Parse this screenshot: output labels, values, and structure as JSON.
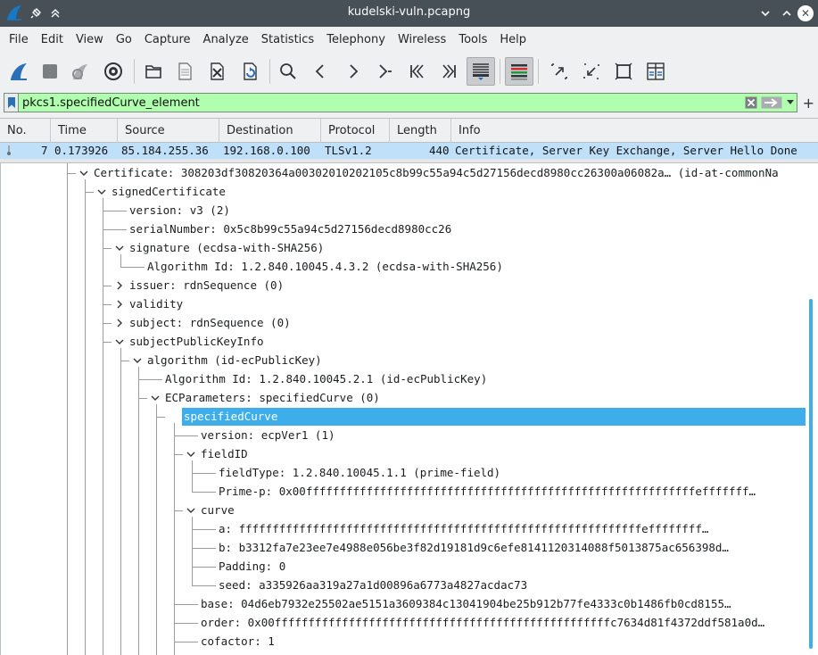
{
  "window": {
    "title": "kudelski-vuln.pcapng"
  },
  "menu": [
    "File",
    "Edit",
    "View",
    "Go",
    "Capture",
    "Analyze",
    "Statistics",
    "Telephony",
    "Wireless",
    "Tools",
    "Help"
  ],
  "toolbar": {
    "icons": [
      "start-capture-icon",
      "stop-capture-icon",
      "restart-capture-icon",
      "capture-options-icon",
      "open-file-icon",
      "save-file-icon",
      "close-file-icon",
      "reload-file-icon",
      "find-packet-icon",
      "go-back-icon",
      "go-forward-icon",
      "go-to-packet-icon",
      "go-first-packet-icon",
      "go-last-packet-icon",
      "auto-scroll-icon",
      "colorize-icon",
      "zoom-in-icon",
      "zoom-out-icon",
      "normal-size-icon",
      "resize-columns-icon"
    ]
  },
  "filter": {
    "value": "pkcs1.specifiedCurve_element",
    "color": "#afffaf"
  },
  "packet_list": {
    "columns": [
      "No.",
      "Time",
      "Source",
      "Destination",
      "Protocol",
      "Length",
      "Info"
    ],
    "row": {
      "no": "7",
      "time": "0.173926",
      "source": "85.184.255.36",
      "destination": "192.168.0.100",
      "protocol": "TLSv1.2",
      "length": "440",
      "info": "Certificate, Server Key Exchange, Server Hello Done"
    },
    "row_color": "#bfe0f8"
  },
  "details": {
    "rows": [
      {
        "text": "Certificate: 308203df30820364a00302010202105c8b99c55a94c5d27156decd8980cc26300a06082a… (id-at-commonNa",
        "expander": "open"
      },
      {
        "text": "signedCertificate",
        "expander": "open"
      },
      {
        "text": "version: v3 (2)",
        "expander": "none"
      },
      {
        "text": "serialNumber: 0x5c8b99c55a94c5d27156decd8980cc26",
        "expander": "none"
      },
      {
        "text": "signature (ecdsa-with-SHA256)",
        "expander": "open"
      },
      {
        "text": "Algorithm Id: 1.2.840.10045.4.3.2 (ecdsa-with-SHA256)",
        "expander": "none"
      },
      {
        "text": "issuer: rdnSequence (0)",
        "expander": "closed"
      },
      {
        "text": "validity",
        "expander": "closed"
      },
      {
        "text": "subject: rdnSequence (0)",
        "expander": "closed"
      },
      {
        "text": "subjectPublicKeyInfo",
        "expander": "open"
      },
      {
        "text": "algorithm (id-ecPublicKey)",
        "expander": "open"
      },
      {
        "text": "Algorithm Id: 1.2.840.10045.2.1 (id-ecPublicKey)",
        "expander": "none"
      },
      {
        "text": "ECParameters: specifiedCurve (0)",
        "expander": "open"
      },
      {
        "text": "specifiedCurve",
        "expander": "open",
        "selected": true
      },
      {
        "text": "version: ecpVer1 (1)",
        "expander": "none"
      },
      {
        "text": "fieldID",
        "expander": "open"
      },
      {
        "text": "fieldType: 1.2.840.10045.1.1 (prime-field)",
        "expander": "none"
      },
      {
        "text": "Prime-p: 0x00ffffffffffffffffffffffffffffffffffffffffffffffffffffffffffefffffff…",
        "expander": "none"
      },
      {
        "text": "curve",
        "expander": "open"
      },
      {
        "text": "a: ffffffffffffffffffffffffffffffffffffffffffffffffffffffffffffeffffffff…",
        "expander": "none"
      },
      {
        "text": "b: b3312fa7e23ee7e4988e056be3f82d19181d9c6efe8141120314088f5013875ac656398d…",
        "expander": "none"
      },
      {
        "text": "Padding: 0",
        "expander": "none"
      },
      {
        "text": "seed: a335926aa319a27a1d00896a6773a4827acdac73",
        "expander": "none"
      },
      {
        "text": "base: 04d6eb7932e25502ae5151a3609384c13041904be25b912b77fe4333c0b1486fb0cd8155…",
        "expander": "none"
      },
      {
        "text": "order: 0x00ffffffffffffffffffffffffffffffffffffffffffffffffffc7634d81f4372ddf581a0d…",
        "expander": "none"
      },
      {
        "text": "cofactor: 1",
        "expander": "none"
      }
    ],
    "selection_color": "#3daee9"
  }
}
